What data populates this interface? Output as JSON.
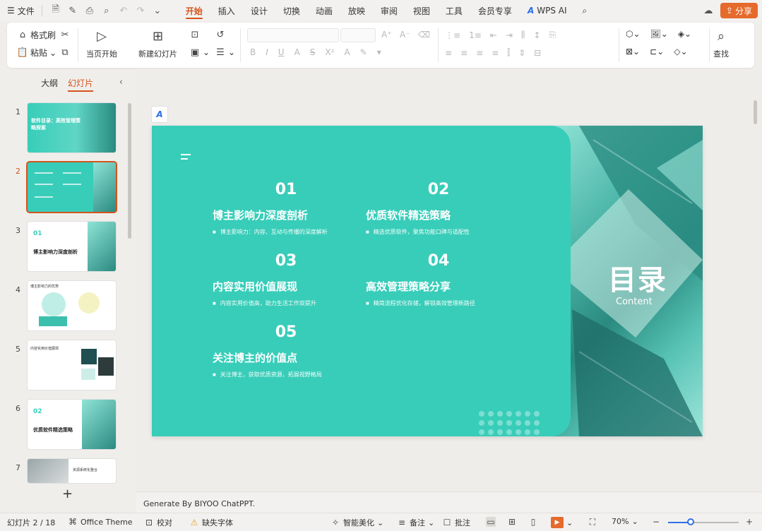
{
  "menubar": {
    "file_label": "文件",
    "tabs": [
      {
        "label": "开始",
        "active": true
      },
      {
        "label": "插入",
        "active": false
      },
      {
        "label": "设计",
        "active": false
      },
      {
        "label": "切换",
        "active": false
      },
      {
        "label": "动画",
        "active": false
      },
      {
        "label": "放映",
        "active": false
      },
      {
        "label": "审阅",
        "active": false
      },
      {
        "label": "视图",
        "active": false
      },
      {
        "label": "工具",
        "active": false
      },
      {
        "label": "会员专享",
        "active": false
      }
    ],
    "ai_tab_label": "WPS AI",
    "share_label": "分享"
  },
  "ribbon": {
    "format_painter": "格式刷",
    "paste": "粘贴",
    "play_from_current": "当页开始",
    "new_slide": "新建幻灯片",
    "find": "查找"
  },
  "left_panel": {
    "tab_outline": "大纲",
    "tab_slides": "幻灯片",
    "slides": [
      {
        "num": "1",
        "title": "软件目录：高效管理策略探索"
      },
      {
        "num": "2",
        "title": ""
      },
      {
        "num": "3",
        "title": "博主影响力深度剖析",
        "badge": "01"
      },
      {
        "num": "4",
        "title": "博主影响力的优势"
      },
      {
        "num": "5",
        "title": "内容实用价值展现"
      },
      {
        "num": "6",
        "title": "优质软件精选策略",
        "badge": "02"
      },
      {
        "num": "7",
        "title": "资源系统化整合"
      }
    ],
    "add_label": "+"
  },
  "slide": {
    "title_cn": "目录",
    "title_en": "Content",
    "items": [
      {
        "num": "01",
        "title": "博主影响力深度剖析",
        "desc": "博主影响力：内容、互动与传播的深度解析"
      },
      {
        "num": "02",
        "title": "优质软件精选策略",
        "desc": "精选优质软件，聚焦功能口碑与适配性"
      },
      {
        "num": "03",
        "title": "内容实用价值展现",
        "desc": "内容实用价值高，助力生活工作双提升"
      },
      {
        "num": "04",
        "title": "高效管理策略分享",
        "desc": "精简流程优化存储，解锁高效管理新路径"
      },
      {
        "num": "05",
        "title": "关注博主的价值点",
        "desc": "关注博主，获取优质资源，拓展视野格局"
      }
    ]
  },
  "notes": {
    "text": "Generate By BIYOO ChatPPT."
  },
  "statusbar": {
    "slide_counter": "幻灯片 2 / 18",
    "theme": "Office Theme",
    "proofread": "校对",
    "missing_font": "缺失字体",
    "smart_beautify": "智能美化",
    "notes": "备注",
    "comments": "批注",
    "zoom": "70%",
    "zoom_value": 0.32
  },
  "colors": {
    "accent": "#d4541c",
    "slide_bg": "#38cdb9",
    "share": "#e56a2c"
  }
}
